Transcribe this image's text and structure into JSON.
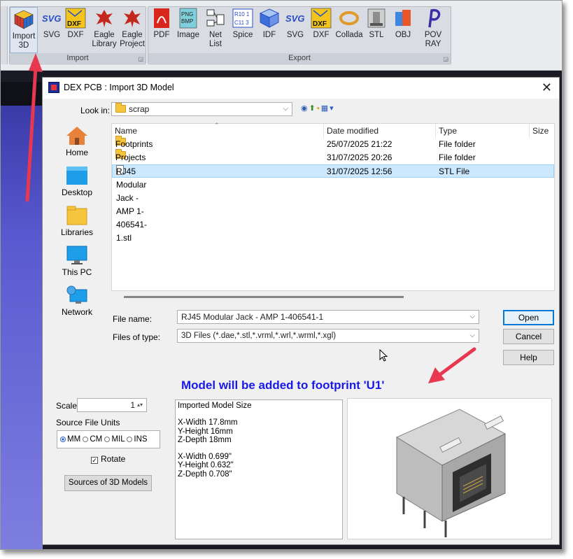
{
  "ribbon": {
    "import_group": {
      "label": "Import",
      "buttons": [
        {
          "label": "Import\n3D",
          "icon": "rubik-cube-icon"
        },
        {
          "label": "SVG",
          "icon": "svg-icon"
        },
        {
          "label": "DXF",
          "icon": "dxf-icon"
        },
        {
          "label": "Eagle\nLibrary",
          "icon": "eagle-icon"
        },
        {
          "label": "Eagle\nProject",
          "icon": "eagle-icon"
        }
      ]
    },
    "export_group": {
      "label": "Export",
      "buttons": [
        {
          "label": "PDF",
          "icon": "pdf-icon"
        },
        {
          "label": "Image",
          "icon": "image-icon"
        },
        {
          "label": "Net List",
          "icon": "netlist-icon"
        },
        {
          "label": "Spice",
          "icon": "spice-icon"
        },
        {
          "label": "IDF",
          "icon": "idf-cube-icon"
        },
        {
          "label": "SVG",
          "icon": "svg-icon"
        },
        {
          "label": "DXF",
          "icon": "dxf-icon"
        },
        {
          "label": "Collada",
          "icon": "collada-ring-icon"
        },
        {
          "label": "STL",
          "icon": "stl-icon"
        },
        {
          "label": "OBJ",
          "icon": "obj-icon"
        },
        {
          "label": "POV RAY",
          "icon": "povray-icon"
        }
      ]
    }
  },
  "dialog": {
    "title": "DEX PCB : Import 3D Model",
    "look_in_label": "Look in:",
    "look_in_value": "scrap",
    "places": [
      {
        "label": "Home",
        "icon": "home-icon"
      },
      {
        "label": "Desktop",
        "icon": "desktop-icon"
      },
      {
        "label": "Libraries",
        "icon": "libraries-folder-icon"
      },
      {
        "label": "This PC",
        "icon": "monitor-icon"
      },
      {
        "label": "Network",
        "icon": "network-icon"
      }
    ],
    "columns": {
      "name": "Name",
      "date": "Date modified",
      "type": "Type",
      "size": "Size"
    },
    "files": [
      {
        "name": "Footprints",
        "date": "25/07/2025 21:22",
        "type": "File folder",
        "kind": "folder"
      },
      {
        "name": "Projects",
        "date": "31/07/2025 20:26",
        "type": "File folder",
        "kind": "folder"
      },
      {
        "name": "RJ45 Modular Jack - AMP 1-406541-1.stl",
        "date": "31/07/2025 12:56",
        "type": "STL File",
        "kind": "file"
      }
    ],
    "file_name_label": "File name:",
    "file_name_value": "RJ45 Modular Jack - AMP 1-406541-1",
    "files_of_type_label": "Files of type:",
    "files_of_type_value": "3D Files (*.dae,*.stl,*.vrml,*.wrl,*.wrml,*.xgl)",
    "open_label": "Open",
    "cancel_label": "Cancel",
    "help_label": "Help",
    "notice": "Model will be added to footprint 'U1'",
    "scale_label": "Scale",
    "scale_value": "1",
    "source_units_label": "Source File Units",
    "units": [
      "MM",
      "CM",
      "MIL",
      "INS"
    ],
    "selected_unit": "MM",
    "rotate_label": "Rotate",
    "sources_button": "Sources of 3D Models",
    "model_size": {
      "heading": "Imported Model Size",
      "x_width_mm": "X-Width  17.8mm",
      "y_height_mm": "Y-Height 16mm",
      "z_depth_mm": "Z-Depth  18mm",
      "x_width_in": "X-Width  0.699\"",
      "y_height_in": "Y-Height 0.632\"",
      "z_depth_in": "Z-Depth  0.708\""
    }
  },
  "colors": {
    "notice": "#1a1ae6",
    "selection": "#cce8ff",
    "arrow": "#e8384f"
  }
}
